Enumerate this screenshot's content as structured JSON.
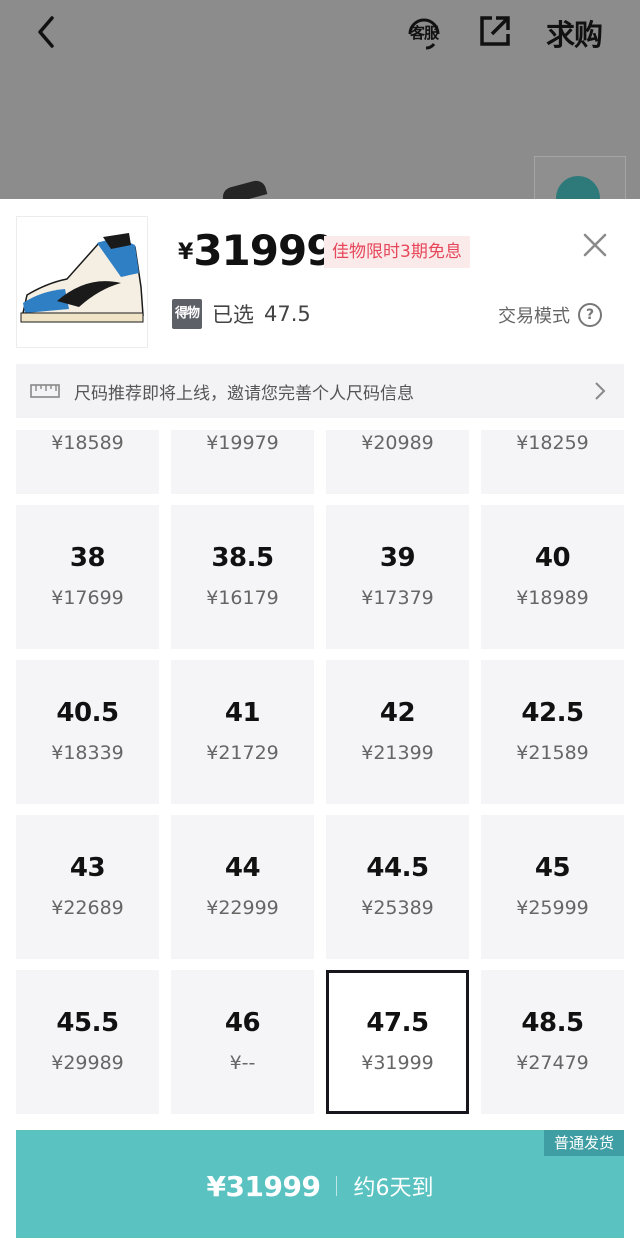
{
  "nav": {
    "customer_service_label": "客服",
    "want_to_buy_label": "求购"
  },
  "sheet": {
    "price_currency": "¥",
    "price_value": "31999",
    "promo_badge": "佳物限时3期免息",
    "selected_label": "已选",
    "selected_value": "47.5",
    "trade_mode_label": "交易模式",
    "help_icon": "?",
    "brand_logo_text": "得物"
  },
  "size_banner": {
    "text": "尺码推荐即将上线，邀请您完善个人尺码信息"
  },
  "sizes": [
    {
      "size": "",
      "price": "¥18589"
    },
    {
      "size": "",
      "price": "¥19979"
    },
    {
      "size": "",
      "price": "¥20989"
    },
    {
      "size": "",
      "price": "¥18259"
    },
    {
      "size": "38",
      "price": "¥17699"
    },
    {
      "size": "38.5",
      "price": "¥16179"
    },
    {
      "size": "39",
      "price": "¥17379"
    },
    {
      "size": "40",
      "price": "¥18989"
    },
    {
      "size": "40.5",
      "price": "¥18339"
    },
    {
      "size": "41",
      "price": "¥21729"
    },
    {
      "size": "42",
      "price": "¥21399"
    },
    {
      "size": "42.5",
      "price": "¥21589"
    },
    {
      "size": "43",
      "price": "¥22689"
    },
    {
      "size": "44",
      "price": "¥22999"
    },
    {
      "size": "44.5",
      "price": "¥25389"
    },
    {
      "size": "45",
      "price": "¥25999"
    },
    {
      "size": "45.5",
      "price": "¥29989"
    },
    {
      "size": "46",
      "price": "¥--"
    },
    {
      "size": "47.5",
      "price": "¥31999",
      "selected": true
    },
    {
      "size": "48.5",
      "price": "¥27479"
    }
  ],
  "buy_bar": {
    "ship_tag": "普通发货",
    "price": "¥31999",
    "eta": "约6天到"
  },
  "colors": {
    "accent_teal": "#5bc2c2",
    "ship_tag_bg": "#3f9ea3",
    "promo_text": "#e6475a",
    "promo_bg": "#fbeaea"
  }
}
